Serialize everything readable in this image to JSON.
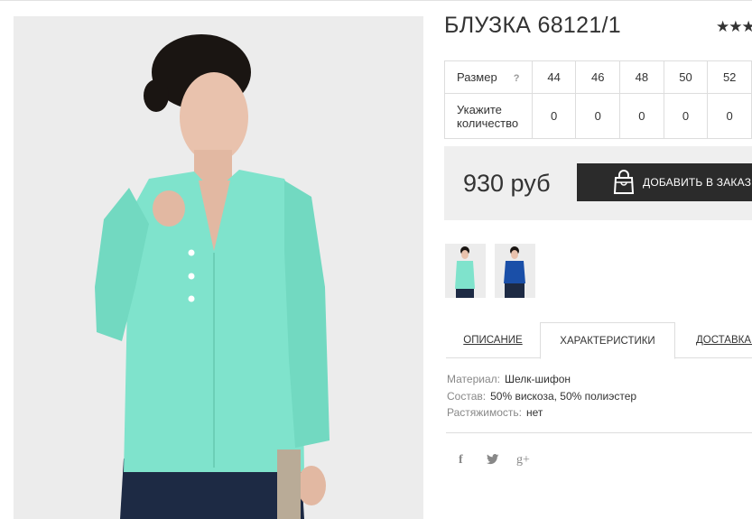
{
  "product": {
    "title": "БЛУЗКА 68121/1",
    "rating_stars": "★★★"
  },
  "size_table": {
    "size_label": "Размер",
    "help_mark": "?",
    "sizes": [
      "44",
      "46",
      "48",
      "50",
      "52"
    ],
    "qty_label": "Укажите количество",
    "quantities": [
      "0",
      "0",
      "0",
      "0",
      "0"
    ]
  },
  "purchase": {
    "price": "930 руб",
    "order_button": "ДОБАВИТЬ В ЗАКАЗ"
  },
  "tabs": [
    {
      "label": "ОПИСАНИЕ",
      "active": false
    },
    {
      "label": "ХАРАКТЕРИСТИКИ",
      "active": true
    },
    {
      "label": "ДОСТАВКА И",
      "active": false
    }
  ],
  "specs": [
    {
      "key": "Материал:",
      "value": "Шелк-шифон"
    },
    {
      "key": "Состав:",
      "value": "50% вискоза, 50% полиэстер"
    },
    {
      "key": "Растяжимость:",
      "value": "нет"
    }
  ],
  "social": {
    "facebook": "f",
    "twitter": "🐦",
    "googleplus": "g+"
  },
  "colors": {
    "blouse_mint": "#7fe3cc",
    "skirt_navy": "#1d2a44",
    "button_dark": "#2b2b2b",
    "thumb_blue": "#1a4fa8"
  }
}
